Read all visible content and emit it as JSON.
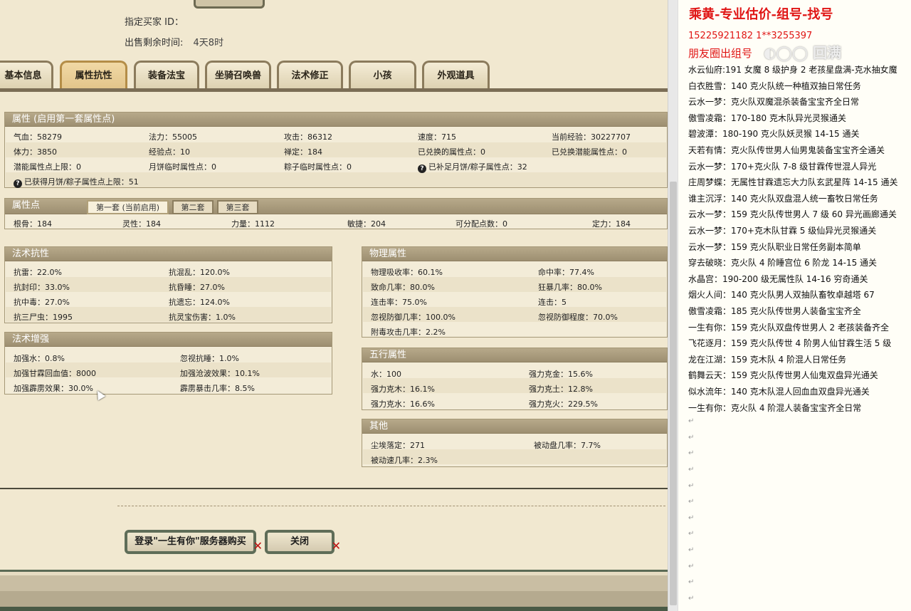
{
  "header": {
    "buyer_label": "指定买家 ID：",
    "buyer_value": "",
    "time_label": "出售剩余时间:",
    "time_value": "4天8时"
  },
  "tabs": [
    {
      "label": "基本信息"
    },
    {
      "label": "属性抗性"
    },
    {
      "label": "装备法宝"
    },
    {
      "label": "坐骑召唤兽"
    },
    {
      "label": "法术修正"
    },
    {
      "label": "小孩"
    },
    {
      "label": "外观道具"
    }
  ],
  "attributes": {
    "title": "属性 (启用第一套属性点)",
    "rows": [
      [
        "气血：58279",
        "法力：55005",
        "攻击：86312",
        "速度：715",
        "当前经验：30227707"
      ],
      [
        "体力：3850",
        "经验点：10",
        "禅定：184",
        "已兑换的属性点：0",
        "已兑换潜能属性点：0"
      ],
      [
        "潜能属性点上限：0",
        "月饼临时属性点：0",
        "粽子临时属性点：0",
        "已补足月饼/粽子属性点：32",
        ""
      ]
    ],
    "extra": "已获得月饼/粽子属性点上限：51"
  },
  "points": {
    "title": "属性点",
    "subtabs": [
      "第一套 (当前启用)",
      "第二套",
      "第三套"
    ],
    "values": [
      "根骨：184",
      "灵性：184",
      "力量：1112",
      "敏捷：204",
      "可分配点数：0",
      "定力：184"
    ]
  },
  "spell_resist": {
    "title": "法术抗性",
    "rows": [
      [
        "抗雷：22.0%",
        "抗混乱：120.0%"
      ],
      [
        "抗封印：33.0%",
        "抗昏睡：27.0%"
      ],
      [
        "抗中毒：27.0%",
        "抗遗忘：124.0%"
      ],
      [
        "抗三尸虫：1995",
        "抗灵宝伤害：1.0%"
      ]
    ]
  },
  "spell_boost": {
    "title": "法术增强",
    "rows": [
      [
        "加强水：0.8%",
        "忽视抗睡：1.0%"
      ],
      [
        "加强甘霖回血值：8000",
        "加强沧波效果：10.1%"
      ],
      [
        "加强霹雳效果：30.0%",
        "霹雳暴击几率：8.5%"
      ]
    ]
  },
  "physical": {
    "title": "物理属性",
    "rows": [
      [
        "物理吸收率：60.1%",
        "命中率：77.4%"
      ],
      [
        "致命几率：80.0%",
        "狂暴几率：80.0%"
      ],
      [
        "连击率：75.0%",
        "连击：5"
      ],
      [
        "忽视防御几率：100.0%",
        "忽视防御程度：70.0%"
      ],
      [
        "附毒攻击几率：2.2%",
        ""
      ]
    ]
  },
  "five_elements": {
    "title": "五行属性",
    "rows": [
      [
        "水：100",
        "强力克金：15.6%"
      ],
      [
        "强力克木：16.1%",
        "强力克土：12.8%"
      ],
      [
        "强力克水：16.6%",
        "强力克火：229.5%"
      ]
    ]
  },
  "other": {
    "title": "其他",
    "rows": [
      [
        "尘埃落定：271",
        "被动盘几率：7.7%"
      ],
      [
        "被动速几率：2.3%",
        ""
      ]
    ]
  },
  "buttons": {
    "buy": "登录\"一生有你\"服务器购买",
    "close": "关闭"
  },
  "note": {
    "title": "乘黄-专业估价-组号-找号",
    "phone": "15225921182   1**3255397",
    "friend": "朋友圈出组号",
    "lines": [
      "水云仙府:191 女魔 8 级护身 2 老孩星盘满-克水抽女魔",
      "白衣胜雪：140 克火队统一种植双抽日常任务",
      "云水一梦：克火队双魔混杀装备宝宝齐全日常",
      "傲雪凌霜：170-180 克木队异光灵猴通关",
      "碧波潭：180-190 克火队妖灵猴 14-15 通关",
      "天若有情：克火队传世男人仙男鬼装备宝宝齐全通关",
      "云水一梦：170+克火队 7-8 级甘霖传世混人异光",
      "庄周梦蝶：无属性甘霖遗忘大力队玄武星阵 14-15 通关",
      "谁主沉浮：140 克火队双盘混人统一畜牧日常任务",
      "云水一梦：159 克火队传世男人 7 级 60 异光画廊通关",
      "云水一梦：170+克木队甘霖 5 级仙异光灵猴通关",
      "云水一梦：159 克火队职业日常任务副本简单",
      "穿去破晓：克火队 4 阶睡宫位 6 阶龙 14-15 通关",
      "水晶宫：190-200 级无属性队 14-16 穷奇通关",
      "烟火人间：140 克火队男人双抽队畜牧卓越塔 67",
      "傲雪凌霜：185 克火队传世男人装备宝宝齐全",
      "一生有你：159 克火队双盘传世男人 2 老孩装备齐全",
      "飞花逐月：159 克火队传世 4 阶男人仙甘霖生活 5 级",
      "龙在江湖：159 克木队 4 阶混人日常任务",
      "鹤舞云天：159 克火队传世男人仙鬼双盘异光通关",
      "似水流年：140 克木队混人回血血双盘异光通关",
      "一生有你：克火队 4 阶混人装备宝宝齐全日常"
    ],
    "para_mark": "↵"
  },
  "colors": {
    "note_red": "#e01515",
    "panel_header": "#a89a7c",
    "tab_active": "#e6c98f"
  }
}
